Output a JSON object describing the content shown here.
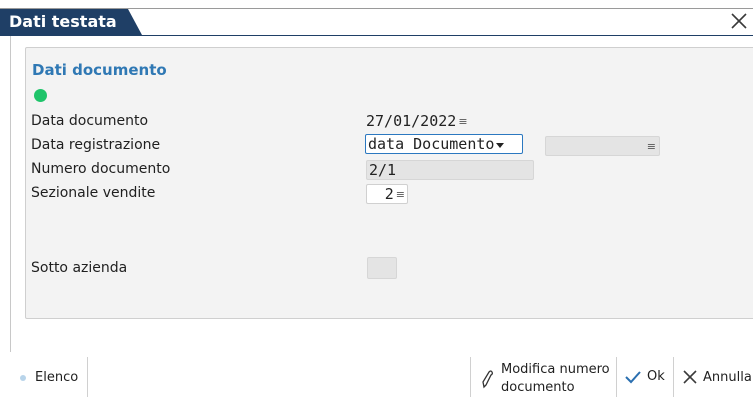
{
  "window": {
    "title": "Dati testata",
    "close_icon": "close-icon"
  },
  "section": {
    "title": "Dati documento",
    "status_color": "#1fc46a"
  },
  "fields": {
    "data_documento": {
      "label": "Data documento",
      "value": "27/01/2022"
    },
    "data_registrazione": {
      "label": "Data registrazione",
      "value": "data Documento",
      "secondary_value": ""
    },
    "numero_documento": {
      "label": "Numero documento",
      "value": "2/1"
    },
    "sezionale_vendite": {
      "label": "Sezionale vendite",
      "value": "2"
    },
    "sotto_azienda": {
      "label": "Sotto azienda",
      "value": ""
    }
  },
  "footer": {
    "elenco_label": "Elenco",
    "modifica_line1": "Modifica numero",
    "modifica_line2": "documento",
    "ok_label": "Ok",
    "annulla_label": "Annulla"
  },
  "colors": {
    "header_bg": "#1f3f66",
    "section_title": "#2f78b4",
    "select_border": "#2b78c0"
  }
}
